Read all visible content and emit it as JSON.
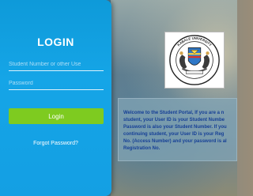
{
  "login": {
    "title": "LOGIN",
    "username_placeholder": "Student Number or other Use",
    "password_placeholder": "Password",
    "submit_label": "Login",
    "forgot_password_label": "Forgot Password?"
  },
  "branding": {
    "logo_text": "KABALE UNIVERSITY"
  },
  "notice": {
    "text": "Welcome to the Student Portal, If you are a n\nstudent, your User ID is your Student Numbe\nPassword is also your Student Number. If you\ncontinuing student, your User ID is your Reg\nNo. (Access Number) and your password is al\nRegistration No."
  },
  "colors": {
    "panel_blue": "#15a5e7",
    "login_green": "#7ecb20",
    "notice_text": "#153f96"
  }
}
